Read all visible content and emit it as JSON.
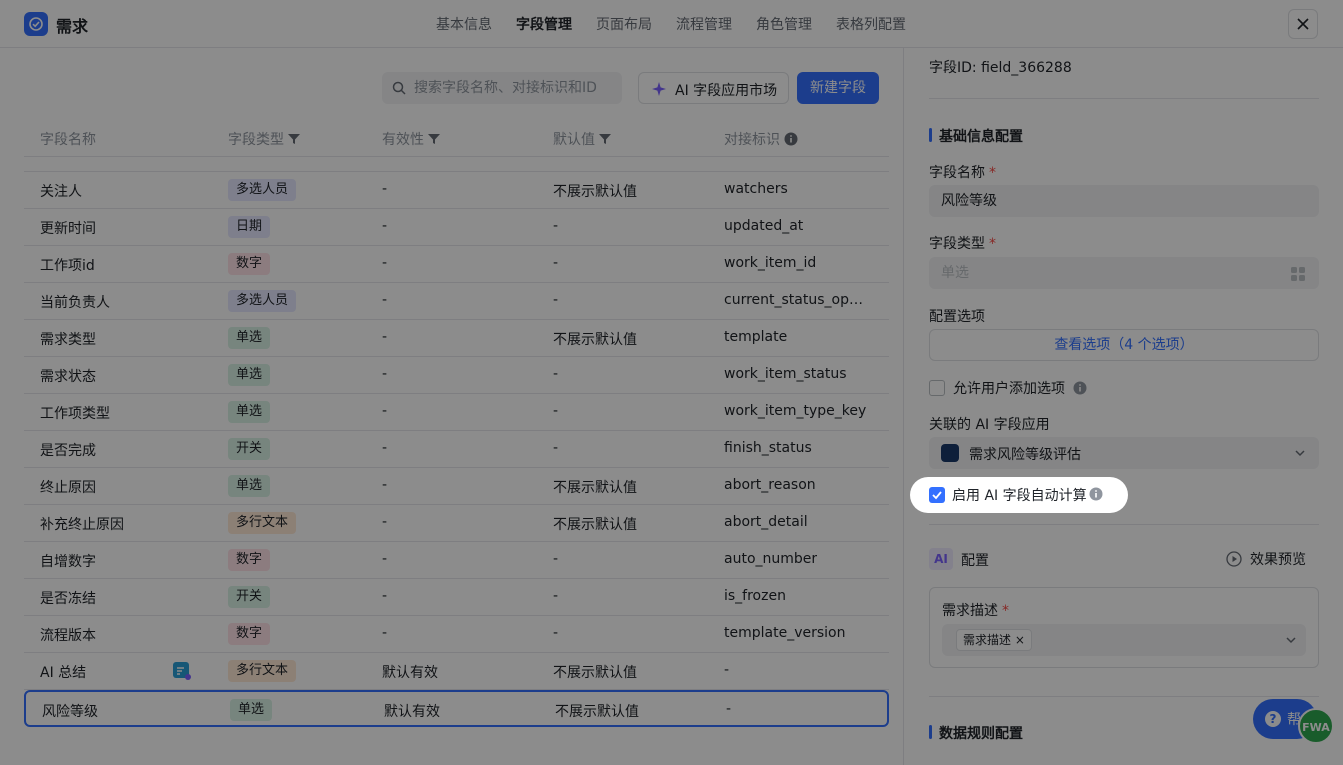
{
  "app": {
    "title": "需求"
  },
  "nav": [
    {
      "label": "基本信息",
      "active": false
    },
    {
      "label": "字段管理",
      "active": true
    },
    {
      "label": "页面布局",
      "active": false
    },
    {
      "label": "流程管理",
      "active": false
    },
    {
      "label": "角色管理",
      "active": false
    },
    {
      "label": "表格列配置",
      "active": false
    }
  ],
  "toolbar": {
    "search_placeholder": "搜索字段名称、对接标识和ID",
    "ai_market_label": "AI 字段应用市场",
    "new_field_label": "新建字段"
  },
  "table": {
    "headers": [
      "字段名称",
      "字段类型",
      "有效性",
      "默认值",
      "对接标识"
    ],
    "rows": [
      {
        "name": "关注人",
        "type": "多选人员",
        "type_color": "#e6e8ff",
        "valid": "-",
        "default": "不展示默认值",
        "key": "watchers"
      },
      {
        "name": "更新时间",
        "type": "日期",
        "type_color": "#e6e8ff",
        "valid": "-",
        "default": "-",
        "key": "updated_at"
      },
      {
        "name": "工作项id",
        "type": "数字",
        "type_color": "#ffe2e8",
        "valid": "-",
        "default": "-",
        "key": "work_item_id"
      },
      {
        "name": "当前负责人",
        "type": "多选人员",
        "type_color": "#e6e8ff",
        "valid": "-",
        "default": "-",
        "key": "current_status_ope..."
      },
      {
        "name": "需求类型",
        "type": "单选",
        "type_color": "#d9f3e6",
        "valid": "-",
        "default": "不展示默认值",
        "key": "template"
      },
      {
        "name": "需求状态",
        "type": "单选",
        "type_color": "#d9f3e6",
        "valid": "-",
        "default": "-",
        "key": "work_item_status"
      },
      {
        "name": "工作项类型",
        "type": "单选",
        "type_color": "#d9f3e6",
        "valid": "-",
        "default": "-",
        "key": "work_item_type_key"
      },
      {
        "name": "是否完成",
        "type": "开关",
        "type_color": "#d9f3e6",
        "valid": "-",
        "default": "-",
        "key": "finish_status"
      },
      {
        "name": "终止原因",
        "type": "单选",
        "type_color": "#d9f3e6",
        "valid": "-",
        "default": "不展示默认值",
        "key": "abort_reason"
      },
      {
        "name": "补充终止原因",
        "type": "多行文本",
        "type_color": "#ffe9d6",
        "valid": "-",
        "default": "不展示默认值",
        "key": "abort_detail"
      },
      {
        "name": "自增数字",
        "type": "数字",
        "type_color": "#ffe2e8",
        "valid": "-",
        "default": "-",
        "key": "auto_number"
      },
      {
        "name": "是否冻结",
        "type": "开关",
        "type_color": "#d9f3e6",
        "valid": "-",
        "default": "-",
        "key": "is_frozen"
      },
      {
        "name": "流程版本",
        "type": "数字",
        "type_color": "#ffe2e8",
        "valid": "-",
        "default": "-",
        "key": "template_version"
      },
      {
        "name": "AI 总结",
        "type": "多行文本",
        "type_color": "#ffe9d6",
        "valid": "默认有效",
        "default": "不展示默认值",
        "key": "-",
        "ai_badge": true
      },
      {
        "name": "风险等级",
        "type": "单选",
        "type_color": "#d9f3e6",
        "valid": "默认有效",
        "default": "不展示默认值",
        "key": "-",
        "selected": true
      }
    ]
  },
  "panel": {
    "field_id": "字段ID:  field_366288",
    "basic_section": "基础信息配置",
    "name_label": "字段名称",
    "name_value": "风险等级",
    "type_label": "字段类型",
    "type_value": "单选",
    "options_label": "配置选项",
    "options_button": "查看选项（4 个选项）",
    "allow_add_label": "允许用户添加选项",
    "ai_app_label": "关联的 AI 字段应用",
    "ai_app_value": "需求风险等级评估",
    "auto_calc_label": "启用 AI 字段自动计算",
    "ai_tag": "AI",
    "config_label": "配置",
    "preview_label": "效果预览",
    "desc_label": "需求描述",
    "desc_chip": "需求描述",
    "data_rules_section": "数据规则配置",
    "help_label": "帮",
    "fwa_label": "FWA"
  },
  "colors": {
    "accent": "#3370ff",
    "required": "#f54a45"
  }
}
